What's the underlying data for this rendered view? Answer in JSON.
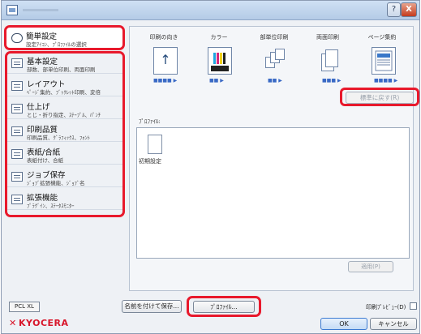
{
  "sidebar": {
    "quick": {
      "label": "簡単設定",
      "sub": "設定ｱｲｺﾝ、ﾌﾟﾛﾌｧｲﾙの選択"
    },
    "items": [
      {
        "label": "基本設定",
        "sub": "部数、部単位印刷、両面印刷"
      },
      {
        "label": "レイアウト",
        "sub": "ﾍﾟｰｼﾞ集約、ﾌﾞｯｸﾚｯﾄ印刷、変倍"
      },
      {
        "label": "仕上げ",
        "sub": "とじ・折り指定、ｽﾃｰﾌﾟﾙ、ﾊﾟﾝﾁ"
      },
      {
        "label": "印刷品質",
        "sub": "印刷品質、ｸﾞﾗﾌｨｯｸｽ、ﾌｫﾝﾄ"
      },
      {
        "label": "表紙/合紙",
        "sub": "表紙付け、合紙"
      },
      {
        "label": "ジョブ保存",
        "sub": "ｼﾞｮﾌﾞ拡張機能、ｼﾞｮﾌﾞ名"
      },
      {
        "label": "拡張機能",
        "sub": "ﾌﾟﾗｸﾞｲﾝ、ｽﾃｰﾀｽﾓﾆﾀｰ"
      }
    ]
  },
  "main": {
    "columns": [
      "印刷の向き",
      "カラー",
      "部単位印刷",
      "両面印刷",
      "ページ集約"
    ],
    "color_icon_text": "CMYK",
    "reset_label": "標準に戻す(R)",
    "profile_label": "ﾌﾟﾛﾌｧｲﾙ:",
    "profile_name": "初期設定",
    "apply_label": "適用(P)"
  },
  "footer": {
    "pdl": "PCL XL",
    "save_as": "名前を付けて保存...",
    "profile_button": "ﾌﾟﾛﾌｧｲﾙ...",
    "preview_label": "印刷ﾌﾟﾚﾋﾞｭｰ(D)",
    "ok": "OK",
    "cancel": "キャンセル",
    "brand": "KYOCERA"
  },
  "titlebar": {
    "help": "?",
    "close": "X"
  }
}
